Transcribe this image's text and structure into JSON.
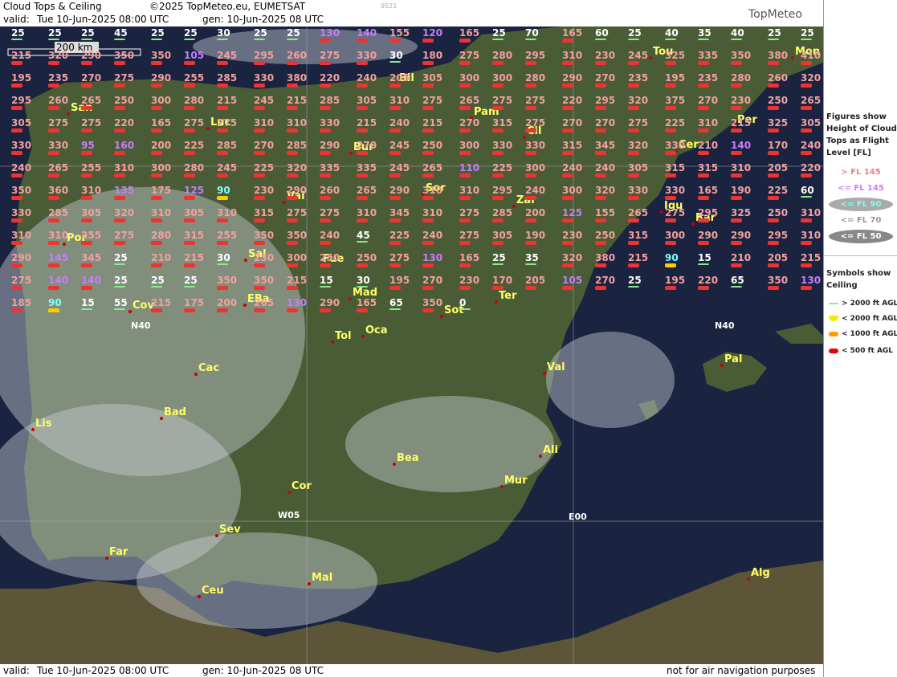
{
  "header": {
    "title": "Cloud Tops & Ceiling",
    "copyright": "©2025 TopMeteo.eu, EUMETSAT",
    "code": "9521",
    "valid_label": "valid:",
    "valid_time": "Tue   10-Jun-2025  08:00 UTC",
    "gen": "gen: 10-Jun-2025 08 UTC",
    "logo": "TopMeteo"
  },
  "footer": {
    "valid_label": "valid:",
    "valid_time": "Tue   10-Jun-2025  08:00 UTC",
    "gen": "gen: 10-Jun-2025 08 UTC",
    "disclaimer": "not for air navigation purposes"
  },
  "map": {
    "scale_label": "200 km",
    "grid_labels": [
      "N40",
      "W05",
      "E00",
      "N40"
    ],
    "cities": [
      "Tou",
      "Mon",
      "Bil",
      "San",
      "Luc",
      "Pam",
      "Cil",
      "Per",
      "Bur",
      "Cer",
      "Val",
      "Sor",
      "Zar",
      "Igu",
      "Bar",
      "Por",
      "Sal",
      "Fue",
      "Mad",
      "Ter",
      "Sot",
      "Cov",
      "EBa",
      "Tol",
      "Oca",
      "Pal",
      "Cac",
      "Val",
      "Bad",
      "Lis",
      "Bea",
      "Ali",
      "Mur",
      "Cor",
      "Sev",
      "Far",
      "Mal",
      "Ceu",
      "Alg"
    ],
    "cloud_labels": [
      {
        "t": "25",
        "c": "g"
      },
      {
        "t": "25",
        "c": "g"
      },
      {
        "t": "25",
        "c": "g"
      },
      {
        "t": "45",
        "c": "g"
      },
      {
        "t": "25",
        "c": "g"
      },
      {
        "t": "25",
        "c": "g"
      },
      {
        "t": "30",
        "c": "g"
      },
      {
        "t": "25",
        "c": "g"
      },
      {
        "t": "25",
        "c": "g"
      },
      {
        "t": "130",
        "c": "p"
      },
      {
        "t": "140",
        "c": "p"
      },
      {
        "t": "155",
        "c": "r"
      },
      {
        "t": "120",
        "c": "p"
      },
      {
        "t": "165",
        "c": "r"
      },
      {
        "t": "25",
        "c": "g"
      },
      {
        "t": "70",
        "c": "g"
      },
      {
        "t": "165",
        "c": "r"
      },
      {
        "t": "60",
        "c": "g"
      },
      {
        "t": "25",
        "c": "g"
      },
      {
        "t": "40",
        "c": "g"
      },
      {
        "t": "35",
        "c": "g"
      },
      {
        "t": "40",
        "c": "g"
      },
      {
        "t": "25",
        "c": "g"
      },
      {
        "t": "25",
        "c": "g"
      },
      {
        "t": "215",
        "c": "r"
      },
      {
        "t": "320",
        "c": "r"
      },
      {
        "t": "290",
        "c": "r"
      },
      {
        "t": "350",
        "c": "r"
      },
      {
        "t": "350",
        "c": "r"
      },
      {
        "t": "105",
        "c": "p"
      },
      {
        "t": "245",
        "c": "r"
      },
      {
        "t": "295",
        "c": "r"
      },
      {
        "t": "260",
        "c": "r"
      },
      {
        "t": "275",
        "c": "r"
      },
      {
        "t": "330",
        "c": "r"
      },
      {
        "t": "30",
        "c": "g"
      },
      {
        "t": "180",
        "c": "r"
      },
      {
        "t": "275",
        "c": "r"
      },
      {
        "t": "280",
        "c": "r"
      },
      {
        "t": "295",
        "c": "r"
      },
      {
        "t": "310",
        "c": "r"
      },
      {
        "t": "230",
        "c": "r"
      },
      {
        "t": "245",
        "c": "r"
      },
      {
        "t": "325",
        "c": "r"
      },
      {
        "t": "335",
        "c": "r"
      },
      {
        "t": "350",
        "c": "r"
      },
      {
        "t": "380",
        "c": "r"
      },
      {
        "t": "410",
        "c": "r"
      },
      {
        "t": "195",
        "c": "r"
      },
      {
        "t": "235",
        "c": "r"
      },
      {
        "t": "270",
        "c": "r"
      },
      {
        "t": "275",
        "c": "r"
      },
      {
        "t": "290",
        "c": "r"
      },
      {
        "t": "255",
        "c": "r"
      },
      {
        "t": "285",
        "c": "r"
      },
      {
        "t": "330",
        "c": "r"
      },
      {
        "t": "380",
        "c": "r"
      },
      {
        "t": "220",
        "c": "r"
      },
      {
        "t": "240",
        "c": "r"
      },
      {
        "t": "205",
        "c": "r"
      },
      {
        "t": "305",
        "c": "r"
      },
      {
        "t": "300",
        "c": "r"
      },
      {
        "t": "300",
        "c": "r"
      },
      {
        "t": "280",
        "c": "r"
      },
      {
        "t": "290",
        "c": "r"
      },
      {
        "t": "270",
        "c": "r"
      },
      {
        "t": "235",
        "c": "r"
      },
      {
        "t": "195",
        "c": "r"
      },
      {
        "t": "235",
        "c": "r"
      },
      {
        "t": "280",
        "c": "r"
      },
      {
        "t": "260",
        "c": "r"
      },
      {
        "t": "320",
        "c": "r"
      },
      {
        "t": "295",
        "c": "r"
      },
      {
        "t": "260",
        "c": "r"
      },
      {
        "t": "265",
        "c": "r"
      },
      {
        "t": "250",
        "c": "r"
      },
      {
        "t": "300",
        "c": "r"
      },
      {
        "t": "280",
        "c": "r"
      },
      {
        "t": "215",
        "c": "r"
      },
      {
        "t": "245",
        "c": "r"
      },
      {
        "t": "215",
        "c": "r"
      },
      {
        "t": "285",
        "c": "r"
      },
      {
        "t": "305",
        "c": "r"
      },
      {
        "t": "310",
        "c": "r"
      },
      {
        "t": "275",
        "c": "r"
      },
      {
        "t": "265",
        "c": "r"
      },
      {
        "t": "275",
        "c": "r"
      },
      {
        "t": "275",
        "c": "r"
      },
      {
        "t": "220",
        "c": "r"
      },
      {
        "t": "295",
        "c": "r"
      },
      {
        "t": "320",
        "c": "r"
      },
      {
        "t": "375",
        "c": "r"
      },
      {
        "t": "270",
        "c": "r"
      },
      {
        "t": "230",
        "c": "r"
      },
      {
        "t": "250",
        "c": "r"
      },
      {
        "t": "265",
        "c": "r"
      },
      {
        "t": "305",
        "c": "r"
      },
      {
        "t": "275",
        "c": "r"
      },
      {
        "t": "275",
        "c": "r"
      },
      {
        "t": "220",
        "c": "r"
      },
      {
        "t": "165",
        "c": "r"
      },
      {
        "t": "275",
        "c": "r"
      },
      {
        "t": "275",
        "c": "r"
      },
      {
        "t": "310",
        "c": "r"
      },
      {
        "t": "310",
        "c": "r"
      },
      {
        "t": "330",
        "c": "r"
      },
      {
        "t": "215",
        "c": "r"
      },
      {
        "t": "240",
        "c": "r"
      },
      {
        "t": "215",
        "c": "r"
      },
      {
        "t": "270",
        "c": "r"
      },
      {
        "t": "315",
        "c": "r"
      },
      {
        "t": "275",
        "c": "r"
      },
      {
        "t": "270",
        "c": "r"
      },
      {
        "t": "270",
        "c": "r"
      },
      {
        "t": "275",
        "c": "r"
      },
      {
        "t": "225",
        "c": "r"
      },
      {
        "t": "310",
        "c": "r"
      },
      {
        "t": "215",
        "c": "r"
      },
      {
        "t": "325",
        "c": "r"
      },
      {
        "t": "305",
        "c": "r"
      },
      {
        "t": "330",
        "c": "r"
      },
      {
        "t": "330",
        "c": "r"
      },
      {
        "t": "95",
        "c": "p"
      },
      {
        "t": "160",
        "c": "p"
      },
      {
        "t": "200",
        "c": "r"
      },
      {
        "t": "225",
        "c": "r"
      },
      {
        "t": "285",
        "c": "r"
      },
      {
        "t": "270",
        "c": "r"
      },
      {
        "t": "285",
        "c": "r"
      },
      {
        "t": "290",
        "c": "r"
      },
      {
        "t": "270",
        "c": "r"
      },
      {
        "t": "245",
        "c": "r"
      },
      {
        "t": "250",
        "c": "r"
      },
      {
        "t": "300",
        "c": "r"
      },
      {
        "t": "330",
        "c": "r"
      },
      {
        "t": "330",
        "c": "r"
      },
      {
        "t": "315",
        "c": "r"
      },
      {
        "t": "345",
        "c": "r"
      },
      {
        "t": "320",
        "c": "r"
      },
      {
        "t": "330",
        "c": "r"
      },
      {
        "t": "210",
        "c": "r"
      },
      {
        "t": "140",
        "c": "p"
      },
      {
        "t": "170",
        "c": "r"
      },
      {
        "t": "240",
        "c": "r"
      },
      {
        "t": "240",
        "c": "r"
      },
      {
        "t": "265",
        "c": "r"
      },
      {
        "t": "255",
        "c": "r"
      },
      {
        "t": "310",
        "c": "r"
      },
      {
        "t": "300",
        "c": "r"
      },
      {
        "t": "280",
        "c": "r"
      },
      {
        "t": "245",
        "c": "r"
      },
      {
        "t": "225",
        "c": "r"
      },
      {
        "t": "320",
        "c": "r"
      },
      {
        "t": "335",
        "c": "r"
      },
      {
        "t": "335",
        "c": "r"
      },
      {
        "t": "245",
        "c": "r"
      },
      {
        "t": "265",
        "c": "r"
      },
      {
        "t": "110",
        "c": "p"
      },
      {
        "t": "225",
        "c": "r"
      },
      {
        "t": "300",
        "c": "r"
      },
      {
        "t": "240",
        "c": "r"
      },
      {
        "t": "240",
        "c": "r"
      },
      {
        "t": "305",
        "c": "r"
      },
      {
        "t": "315",
        "c": "r"
      },
      {
        "t": "315",
        "c": "r"
      },
      {
        "t": "310",
        "c": "r"
      },
      {
        "t": "205",
        "c": "r"
      },
      {
        "t": "220",
        "c": "r"
      },
      {
        "t": "350",
        "c": "r"
      },
      {
        "t": "360",
        "c": "r"
      },
      {
        "t": "310",
        "c": "r"
      },
      {
        "t": "135",
        "c": "p"
      },
      {
        "t": "175",
        "c": "r"
      },
      {
        "t": "125",
        "c": "p"
      },
      {
        "t": "90",
        "c": "c"
      },
      {
        "t": "230",
        "c": "r"
      },
      {
        "t": "290",
        "c": "r"
      },
      {
        "t": "260",
        "c": "r"
      },
      {
        "t": "265",
        "c": "r"
      },
      {
        "t": "290",
        "c": "r"
      },
      {
        "t": "310",
        "c": "r"
      },
      {
        "t": "310",
        "c": "r"
      },
      {
        "t": "295",
        "c": "r"
      },
      {
        "t": "240",
        "c": "r"
      },
      {
        "t": "300",
        "c": "r"
      },
      {
        "t": "320",
        "c": "r"
      },
      {
        "t": "330",
        "c": "r"
      },
      {
        "t": "330",
        "c": "r"
      },
      {
        "t": "165",
        "c": "r"
      },
      {
        "t": "190",
        "c": "r"
      },
      {
        "t": "225",
        "c": "r"
      },
      {
        "t": "60",
        "c": "g"
      },
      {
        "t": "330",
        "c": "r"
      },
      {
        "t": "285",
        "c": "r"
      },
      {
        "t": "305",
        "c": "r"
      },
      {
        "t": "320",
        "c": "r"
      },
      {
        "t": "310",
        "c": "r"
      },
      {
        "t": "305",
        "c": "r"
      },
      {
        "t": "310",
        "c": "r"
      },
      {
        "t": "315",
        "c": "r"
      },
      {
        "t": "275",
        "c": "r"
      },
      {
        "t": "275",
        "c": "r"
      },
      {
        "t": "310",
        "c": "r"
      },
      {
        "t": "345",
        "c": "r"
      },
      {
        "t": "310",
        "c": "r"
      },
      {
        "t": "275",
        "c": "r"
      },
      {
        "t": "285",
        "c": "r"
      },
      {
        "t": "200",
        "c": "r"
      },
      {
        "t": "125",
        "c": "p"
      },
      {
        "t": "155",
        "c": "r"
      },
      {
        "t": "265",
        "c": "r"
      },
      {
        "t": "275",
        "c": "r"
      },
      {
        "t": "295",
        "c": "r"
      },
      {
        "t": "325",
        "c": "r"
      },
      {
        "t": "250",
        "c": "r"
      },
      {
        "t": "310",
        "c": "r"
      },
      {
        "t": "310",
        "c": "r"
      },
      {
        "t": "310",
        "c": "r"
      },
      {
        "t": "255",
        "c": "r"
      },
      {
        "t": "275",
        "c": "r"
      },
      {
        "t": "280",
        "c": "r"
      },
      {
        "t": "315",
        "c": "r"
      },
      {
        "t": "255",
        "c": "r"
      },
      {
        "t": "350",
        "c": "r"
      },
      {
        "t": "350",
        "c": "r"
      },
      {
        "t": "240",
        "c": "r"
      },
      {
        "t": "45",
        "c": "g"
      },
      {
        "t": "225",
        "c": "r"
      },
      {
        "t": "240",
        "c": "r"
      },
      {
        "t": "275",
        "c": "r"
      },
      {
        "t": "305",
        "c": "r"
      },
      {
        "t": "190",
        "c": "r"
      },
      {
        "t": "230",
        "c": "r"
      },
      {
        "t": "250",
        "c": "r"
      },
      {
        "t": "315",
        "c": "r"
      },
      {
        "t": "300",
        "c": "r"
      },
      {
        "t": "290",
        "c": "r"
      },
      {
        "t": "290",
        "c": "r"
      },
      {
        "t": "295",
        "c": "r"
      },
      {
        "t": "310",
        "c": "r"
      },
      {
        "t": "290",
        "c": "r"
      },
      {
        "t": "145",
        "c": "p"
      },
      {
        "t": "345",
        "c": "r"
      },
      {
        "t": "25",
        "c": "g"
      },
      {
        "t": "210",
        "c": "r"
      },
      {
        "t": "215",
        "c": "r"
      },
      {
        "t": "30",
        "c": "g"
      },
      {
        "t": "230",
        "c": "r"
      },
      {
        "t": "300",
        "c": "r"
      },
      {
        "t": "250",
        "c": "r"
      },
      {
        "t": "250",
        "c": "r"
      },
      {
        "t": "275",
        "c": "r"
      },
      {
        "t": "130",
        "c": "p"
      },
      {
        "t": "165",
        "c": "r"
      },
      {
        "t": "25",
        "c": "g"
      },
      {
        "t": "35",
        "c": "g"
      },
      {
        "t": "320",
        "c": "r"
      },
      {
        "t": "380",
        "c": "r"
      },
      {
        "t": "215",
        "c": "r"
      },
      {
        "t": "90",
        "c": "c"
      },
      {
        "t": "15",
        "c": "g"
      },
      {
        "t": "210",
        "c": "r"
      },
      {
        "t": "205",
        "c": "r"
      },
      {
        "t": "215",
        "c": "r"
      },
      {
        "t": "275",
        "c": "r"
      },
      {
        "t": "140",
        "c": "p"
      },
      {
        "t": "140",
        "c": "p"
      },
      {
        "t": "25",
        "c": "g"
      },
      {
        "t": "25",
        "c": "g"
      },
      {
        "t": "25",
        "c": "g"
      },
      {
        "t": "350",
        "c": "r"
      },
      {
        "t": "350",
        "c": "r"
      },
      {
        "t": "215",
        "c": "r"
      },
      {
        "t": "15",
        "c": "g"
      },
      {
        "t": "30",
        "c": "g"
      },
      {
        "t": "195",
        "c": "r"
      },
      {
        "t": "270",
        "c": "r"
      },
      {
        "t": "230",
        "c": "r"
      },
      {
        "t": "170",
        "c": "r"
      },
      {
        "t": "205",
        "c": "r"
      },
      {
        "t": "105",
        "c": "p"
      },
      {
        "t": "270",
        "c": "r"
      },
      {
        "t": "25",
        "c": "g"
      },
      {
        "t": "195",
        "c": "r"
      },
      {
        "t": "220",
        "c": "r"
      },
      {
        "t": "65",
        "c": "g"
      },
      {
        "t": "350",
        "c": "r"
      },
      {
        "t": "130",
        "c": "p"
      },
      {
        "t": "185",
        "c": "r"
      },
      {
        "t": "90",
        "c": "c"
      },
      {
        "t": "15",
        "c": "g"
      },
      {
        "t": "55",
        "c": "g"
      },
      {
        "t": "215",
        "c": "r"
      },
      {
        "t": "175",
        "c": "r"
      },
      {
        "t": "200",
        "c": "r"
      },
      {
        "t": "265",
        "c": "r"
      },
      {
        "t": "130",
        "c": "p"
      },
      {
        "t": "290",
        "c": "r"
      },
      {
        "t": "165",
        "c": "r"
      },
      {
        "t": "65",
        "c": "g"
      },
      {
        "t": "350",
        "c": "r"
      },
      {
        "t": "0",
        "c": "g"
      }
    ]
  },
  "legend": {
    "title": [
      "Figures show",
      "Height of Cloud",
      "Tops as Flight",
      "Level  [FL]"
    ],
    "fl": [
      {
        "label": "> FL 145",
        "color": "#f08080"
      },
      {
        "label": "<= FL 145",
        "color": "#d27aff"
      },
      {
        "label": "<= FL 90",
        "color": "#7ff"
      },
      {
        "label": "<= FL 70",
        "color": "#999"
      },
      {
        "label": "<= FL 50",
        "color": "#fff"
      }
    ],
    "sym_title": [
      "Symbols show",
      "Ceiling"
    ],
    "sym": [
      {
        "label": "> 2000 ft AGL",
        "color": "#8e8"
      },
      {
        "label": "< 2000 ft AGL",
        "color": "#ee0"
      },
      {
        "label": "< 1000 ft AGL",
        "color": "#f90"
      },
      {
        "label": "< 500 ft AGL",
        "color": "#e00"
      }
    ]
  }
}
